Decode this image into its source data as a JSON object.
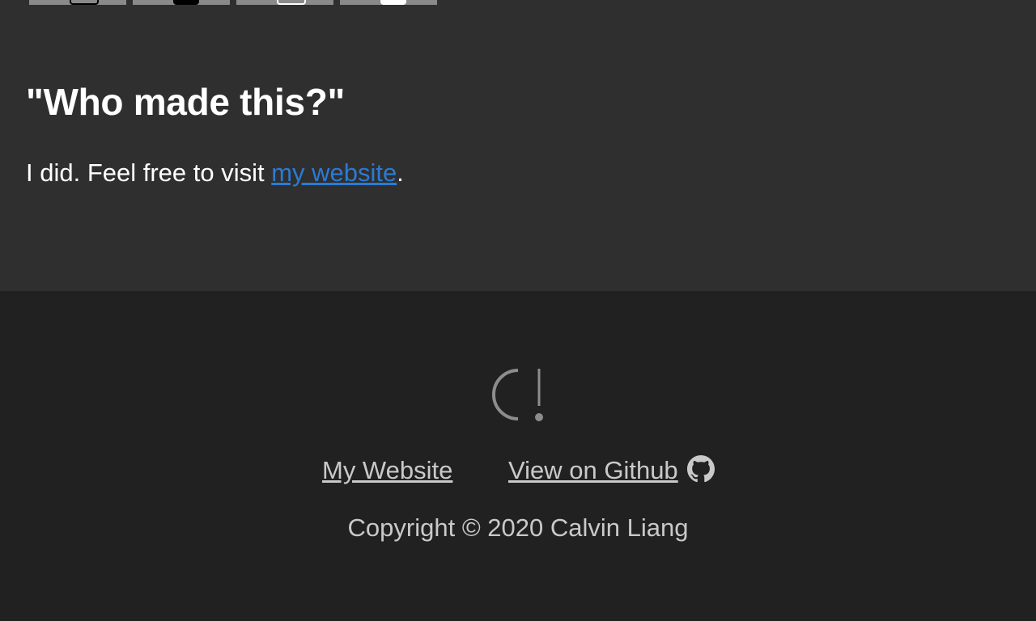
{
  "about": {
    "heading": "\"Who made this?\"",
    "text_before_link": "I did. Feel free to visit ",
    "link_label": "my website",
    "text_after_link": "."
  },
  "footer": {
    "logo_icon": "calvin-logo-icon",
    "links": [
      {
        "label": "My Website"
      },
      {
        "label": "View on Github",
        "icon": "github-icon"
      }
    ],
    "copyright": "Copyright © 2020 Calvin Liang"
  },
  "colors": {
    "upper_background": "#2f2f2f",
    "footer_background": "#212121",
    "link_blue": "#2a7bd4",
    "footer_text": "#c9c9c9"
  }
}
